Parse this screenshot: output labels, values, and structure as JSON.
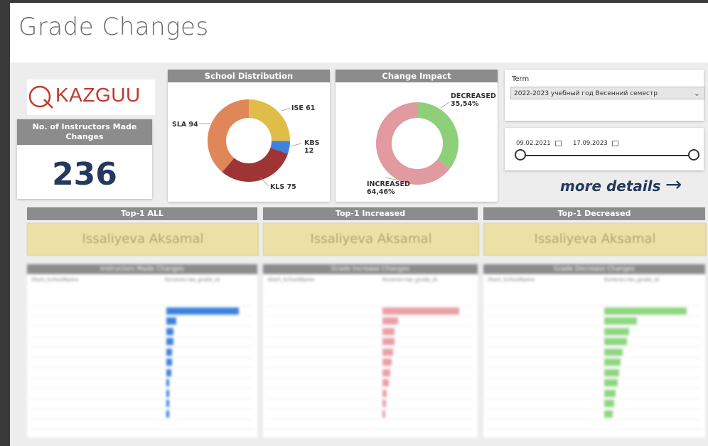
{
  "page": {
    "title": "Grade Changes"
  },
  "logo": {
    "text": "KAZGUU"
  },
  "kpi": {
    "label": "No. of Instructors Made Changes",
    "value": "236"
  },
  "school_distribution": {
    "title": "School Distribution",
    "slices": [
      {
        "label": "ISE 61",
        "value": 61,
        "color": "#e0bd48"
      },
      {
        "label": "KBS 12",
        "value": 12,
        "color": "#3d82e0"
      },
      {
        "label": "KLS 75",
        "value": 75,
        "color": "#9e3434"
      },
      {
        "label": "SLA 94",
        "value": 94,
        "color": "#e0875a"
      }
    ]
  },
  "change_impact": {
    "title": "Change Impact",
    "slices": [
      {
        "label": "DECREASED",
        "pct": "35,54%",
        "value": 35.54,
        "color": "#8ecf7a"
      },
      {
        "label": "INCREASED",
        "pct": "64,46%",
        "value": 64.46,
        "color": "#e09aa0"
      }
    ]
  },
  "term_slicer": {
    "label": "Term",
    "value": "2022-2023 учебный год Весенний семестр"
  },
  "date_slicer": {
    "start": "09.02.2021",
    "end": "17.09.2023"
  },
  "more_details": {
    "label": "more details"
  },
  "top_cards": [
    {
      "title": "Top-1 ALL",
      "name": "Issaliyeva Aksamal"
    },
    {
      "title": "Top-1 Increased",
      "name": "Issaliyeva Aksamal"
    },
    {
      "title": "Top-1 Decreased",
      "name": "Issaliyeva Aksamal"
    }
  ],
  "matrices": [
    {
      "title": "Instructors Made Changes",
      "col1": "Short_SchoolName",
      "col2": "Количество_grade_id",
      "color": "#3d82e0"
    },
    {
      "title": "Grade Increase Changes",
      "col1": "Short_SchoolName",
      "col2": "Количество_grade_id",
      "color": "#e8a0a6"
    },
    {
      "title": "Grade Decrease Changes",
      "col1": "Short_SchoolName",
      "col2": "Количество_grade_id",
      "color": "#8ed680"
    }
  ]
}
